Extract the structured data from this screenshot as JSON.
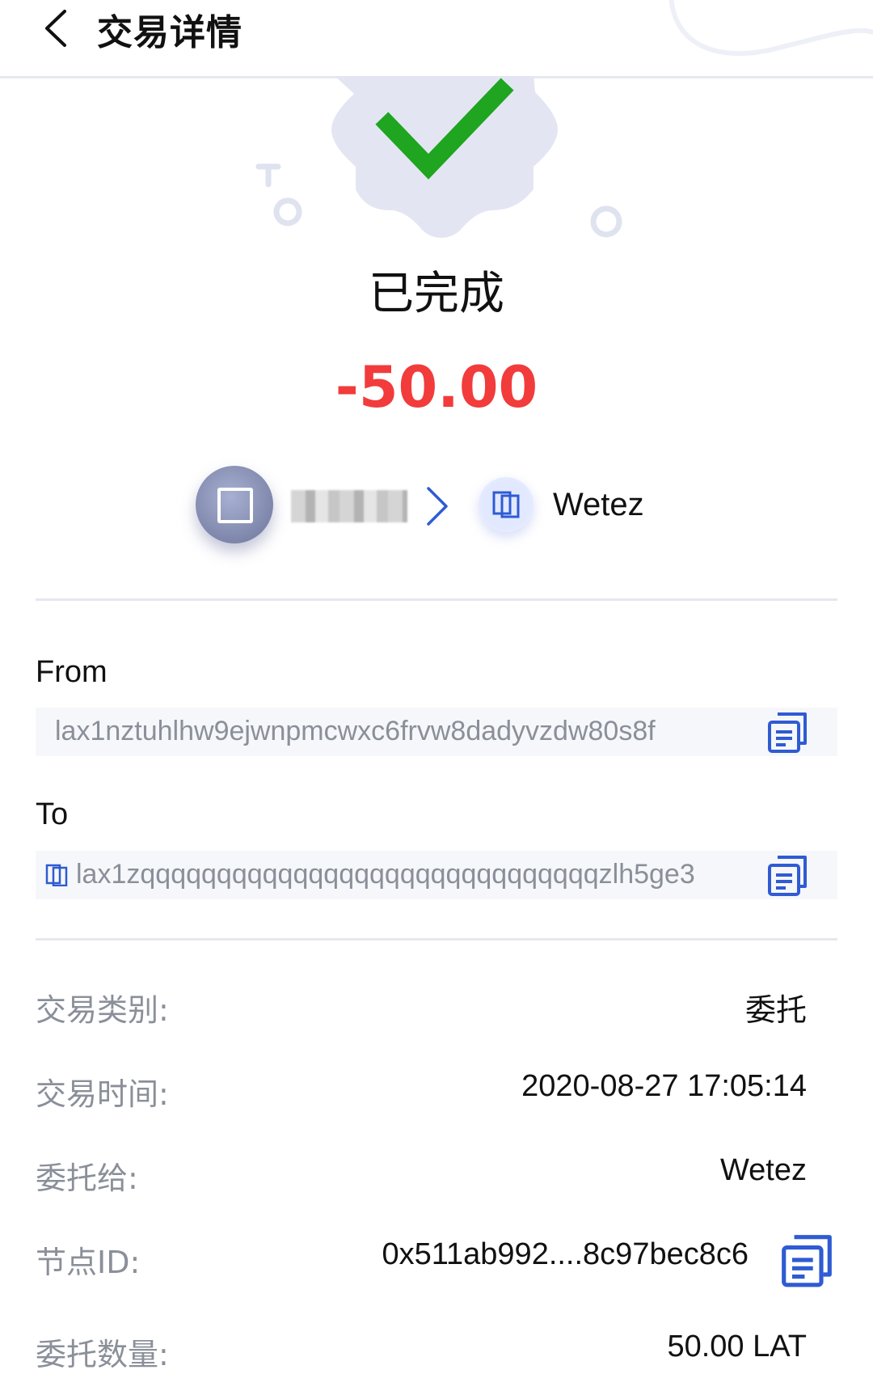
{
  "header": {
    "title": "交易详情"
  },
  "status": {
    "text": "已完成"
  },
  "amount": "-50.00",
  "flow": {
    "to_name": "Wetez"
  },
  "from": {
    "label": "From",
    "address": "lax1nztuhlhw9ejwnpmcwxc6frvw8dadyvzdw80s8f"
  },
  "to": {
    "label": "To",
    "address": "lax1zqqqqqqqqqqqqqqqqqqqqqqqqqqqqqqzlh5ge3"
  },
  "details": [
    {
      "label": "交易类别:",
      "value": "委托"
    },
    {
      "label": "交易时间:",
      "value": "2020-08-27 17:05:14"
    },
    {
      "label": "委托给:",
      "value": "Wetez"
    },
    {
      "label": "节点ID:",
      "value": "0x511ab992....8c97bec8c6"
    },
    {
      "label": "委托数量:",
      "value": "50.00 LAT"
    }
  ],
  "colors": {
    "accent": "#2f5bd3",
    "amount": "#f23b3b",
    "success": "#1fa51f"
  },
  "icons": [
    "back-icon",
    "check-icon",
    "copy-icon",
    "node-icon",
    "chevron-right-icon"
  ]
}
